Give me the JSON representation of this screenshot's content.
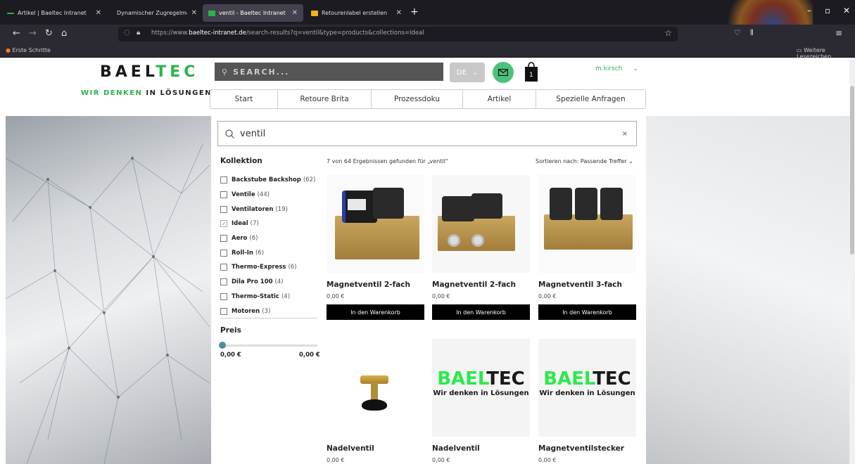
{
  "browser": {
    "tabs": [
      {
        "label": "Artikel | Baeltec Intranet",
        "active": false
      },
      {
        "label": "Dynamischer Zugregelmotor | B",
        "active": false
      },
      {
        "label": "ventil - Baeltec Intranet",
        "active": true
      },
      {
        "label": "Retourenlabel erstellen",
        "active": false
      }
    ],
    "url_prefix": "https://www.",
    "url_domain": "baeltec-intranet.de",
    "url_path": "/search-results?q=ventil&type=products&collections=Ideal",
    "bookmark_left": "Erste Schritte",
    "bookmark_right": "Weitere Lesezeichen"
  },
  "site": {
    "logo_main": "BAEL",
    "logo_accent": "TEC",
    "slogan_1": "WIR ",
    "slogan_2": "DENKEN",
    "slogan_3": " IN LÖSUNGEN",
    "search_placeholder": "SEARCH...",
    "language": "DE",
    "cart_count": "1",
    "user": "m.kirsch",
    "nav": [
      "Start",
      "Retoure Brita",
      "Prozessdoku",
      "Artikel",
      "Spezielle Anfragen"
    ]
  },
  "search": {
    "query": "ventil",
    "clear": "×",
    "results_text": "7 von 64 Ergebnissen gefunden für „ventil\"",
    "sort_label": "Sortieren nach: Passende Treffer"
  },
  "filters": {
    "collection_title": "Kollektion",
    "collections": [
      {
        "name": "Backstube Backshop",
        "count": "(62)",
        "checked": false
      },
      {
        "name": "Ventile",
        "count": "(44)",
        "checked": false
      },
      {
        "name": "Ventilatoren",
        "count": "(19)",
        "checked": false
      },
      {
        "name": "Ideal",
        "count": "(7)",
        "checked": true
      },
      {
        "name": "Aero",
        "count": "(6)",
        "checked": false
      },
      {
        "name": "Roll-In",
        "count": "(6)",
        "checked": false
      },
      {
        "name": "Thermo-Express",
        "count": "(6)",
        "checked": false
      },
      {
        "name": "Dila Pro 100",
        "count": "(4)",
        "checked": false
      },
      {
        "name": "Thermo-Static",
        "count": "(4)",
        "checked": false
      },
      {
        "name": "Motoren",
        "count": "(3)",
        "checked": false
      }
    ],
    "price_title": "Preis",
    "price_min": "0,00 €",
    "price_max": "0,00 €"
  },
  "products": [
    {
      "name": "Magnetventil 2-fach",
      "price": "0,00 €",
      "button": "In den Warenkorb"
    },
    {
      "name": "Magnetventil 2-fach",
      "price": "0,00 €",
      "button": "In den Warenkorb"
    },
    {
      "name": "Magnetventil 3-fach",
      "price": "0,00 €",
      "button": "In den Warenkorb"
    },
    {
      "name": "Nadelventil",
      "price": "0,00 €"
    },
    {
      "name": "Nadelventil",
      "price": "0,00 €"
    },
    {
      "name": "Magnetventilstecker",
      "price": "0,00 €"
    }
  ],
  "placeholder_logo": {
    "main": "BAEL",
    "accent": "TEC",
    "tagline": "Wir denken in Lösungen"
  }
}
